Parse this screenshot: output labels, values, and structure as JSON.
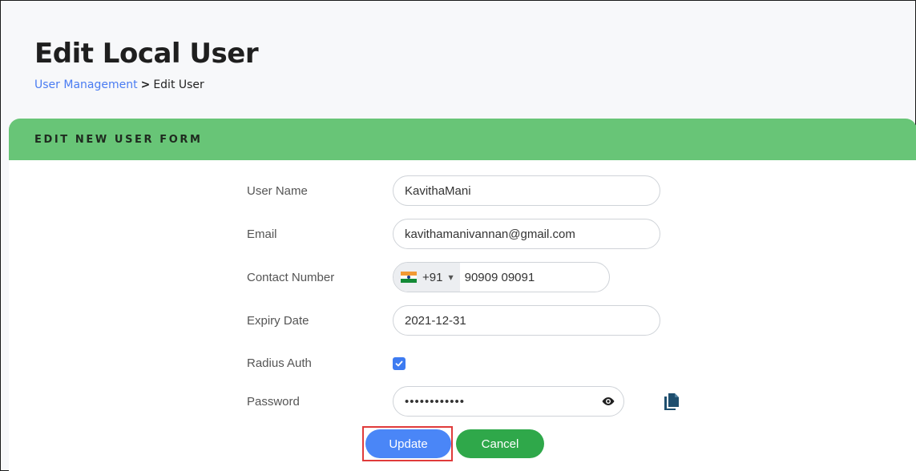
{
  "page": {
    "title": "Edit Local User"
  },
  "breadcrumb": {
    "parent": "User Management",
    "separator": ">",
    "current": "Edit User"
  },
  "form": {
    "header": "EDIT NEW USER FORM",
    "fields": {
      "username": {
        "label": "User Name",
        "value": "KavithaMani"
      },
      "email": {
        "label": "Email",
        "value": "kavithamanivannan@gmail.com"
      },
      "contact": {
        "label": "Contact Number",
        "dial_code": "+91",
        "country_flag": "india-flag-icon",
        "value": "90909 09091"
      },
      "expiry": {
        "label": "Expiry Date",
        "value": "2021-12-31"
      },
      "radius_auth": {
        "label": "Radius Auth",
        "checked": true
      },
      "password": {
        "label": "Password",
        "value": "••••••••••••"
      }
    },
    "buttons": {
      "update": "Update",
      "cancel": "Cancel"
    }
  },
  "colors": {
    "header_bg": "#68c577",
    "update_bg": "#4a86f7",
    "cancel_bg": "#2fa84a",
    "link": "#4a7cf2",
    "highlight": "#e03b3b"
  },
  "icons": {
    "eye": "eye-icon",
    "copy": "copy-icon",
    "check": "check-icon",
    "caret": "caret-down-icon"
  }
}
